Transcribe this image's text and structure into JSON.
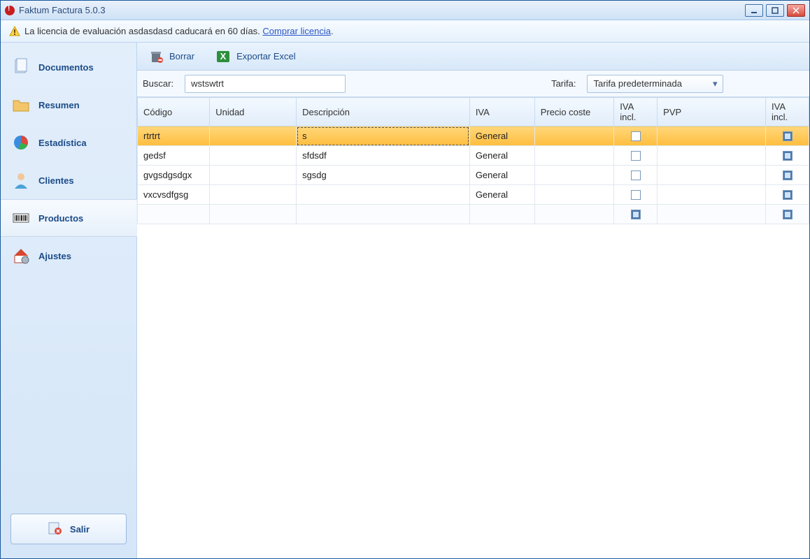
{
  "window": {
    "title": "Faktum Factura 5.0.3"
  },
  "notice": {
    "text_prefix": "La licencia de evaluación asdasdasd caducará en 60 días. ",
    "link_text": "Comprar licencia",
    "text_suffix": "."
  },
  "sidebar": {
    "items": [
      {
        "label": "Documentos"
      },
      {
        "label": "Resumen"
      },
      {
        "label": "Estadística"
      },
      {
        "label": "Clientes"
      },
      {
        "label": "Productos"
      },
      {
        "label": "Ajustes"
      }
    ],
    "active_index": 4,
    "exit_label": "Salir"
  },
  "toolbar": {
    "borrar_label": "Borrar",
    "export_label": "Exportar Excel"
  },
  "filters": {
    "search_label": "Buscar:",
    "search_value": "wstswtrt",
    "tarifa_label": "Tarifa:",
    "tarifa_value": "Tarifa predeterminada"
  },
  "table": {
    "columns": {
      "codigo": "Código",
      "unidad": "Unidad",
      "descripcion": "Descripción",
      "iva": "IVA",
      "precio_coste": "Precio coste",
      "iva_incl_1": "IVA incl.",
      "pvp": "PVP",
      "iva_incl_2": "IVA incl."
    },
    "rows": [
      {
        "codigo": "rtrtrt",
        "unidad": "",
        "descripcion": "s",
        "iva": "General",
        "precio_coste": "",
        "iva_incl_1": false,
        "pvp": "",
        "iva_incl_2": true
      },
      {
        "codigo": "gedsf",
        "unidad": "",
        "descripcion": "sfdsdf",
        "iva": "General",
        "precio_coste": "",
        "iva_incl_1": false,
        "pvp": "",
        "iva_incl_2": true
      },
      {
        "codigo": "gvgsdgsdgx",
        "unidad": "",
        "descripcion": "sgsdg",
        "iva": "General",
        "precio_coste": "",
        "iva_incl_1": false,
        "pvp": "",
        "iva_incl_2": true
      },
      {
        "codigo": "vxcvsdfgsg",
        "unidad": "",
        "descripcion": "",
        "iva": "General",
        "precio_coste": "",
        "iva_incl_1": false,
        "pvp": "",
        "iva_incl_2": true
      }
    ],
    "footer": {
      "iva_incl_1": true,
      "iva_incl_2": true
    },
    "selected_index": 0
  }
}
